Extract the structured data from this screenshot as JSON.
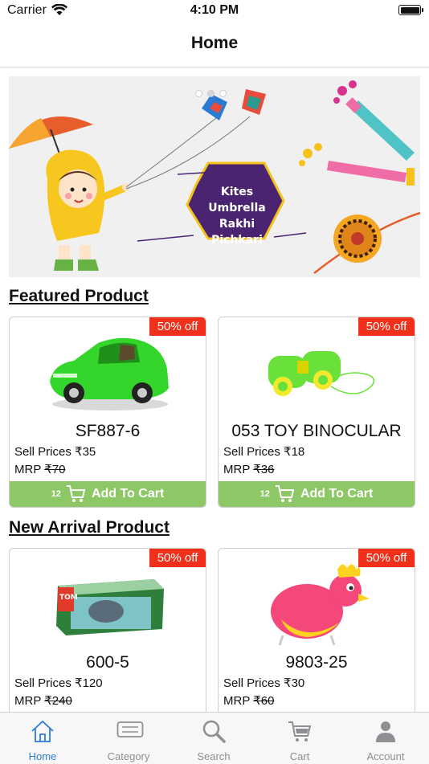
{
  "status_bar": {
    "carrier": "Carrier",
    "time": "4:10 PM"
  },
  "nav": {
    "title": "Home"
  },
  "banner": {
    "lines": [
      "Kites",
      "Umbrella",
      "Rakhi",
      "Pichkari"
    ],
    "active_dot": 0,
    "dot_count": 3
  },
  "featured": {
    "title": "Featured Product",
    "products": [
      {
        "name": "SF887-6",
        "discount": "50% off",
        "sell_label": "Sell Prices",
        "sell_price": "₹35",
        "mrp_label": "MRP",
        "mrp": "₹70",
        "cart_qty": "12",
        "cart_label": "Add To Cart"
      },
      {
        "name": "053 TOY BINOCULAR",
        "discount": "50% off",
        "sell_label": "Sell Prices",
        "sell_price": "₹18",
        "mrp_label": "MRP",
        "mrp": "₹36",
        "cart_qty": "12",
        "cart_label": "Add To Cart"
      }
    ]
  },
  "new_arrival": {
    "title": "New Arrival Product",
    "products": [
      {
        "name": "600-5",
        "discount": "50% off",
        "sell_label": "Sell Prices",
        "sell_price": "₹120",
        "mrp_label": "MRP",
        "mrp": "₹240"
      },
      {
        "name": "9803-25",
        "discount": "50% off",
        "sell_label": "Sell Prices",
        "sell_price": "₹30",
        "mrp_label": "MRP",
        "mrp": "₹60"
      }
    ]
  },
  "tabs": [
    {
      "label": "Home",
      "icon": "home-icon",
      "active": true
    },
    {
      "label": "Category",
      "icon": "category-icon",
      "active": false
    },
    {
      "label": "Search",
      "icon": "search-icon",
      "active": false
    },
    {
      "label": "Cart",
      "icon": "cart-icon",
      "active": false
    },
    {
      "label": "Account",
      "icon": "account-icon",
      "active": false
    }
  ],
  "colors": {
    "badge": "#f1301c",
    "add_to_cart": "#8ec766",
    "tab_active": "#2d7bd8",
    "tab_inactive": "#8e8e93",
    "banner_hexagon": "#4a2470"
  }
}
